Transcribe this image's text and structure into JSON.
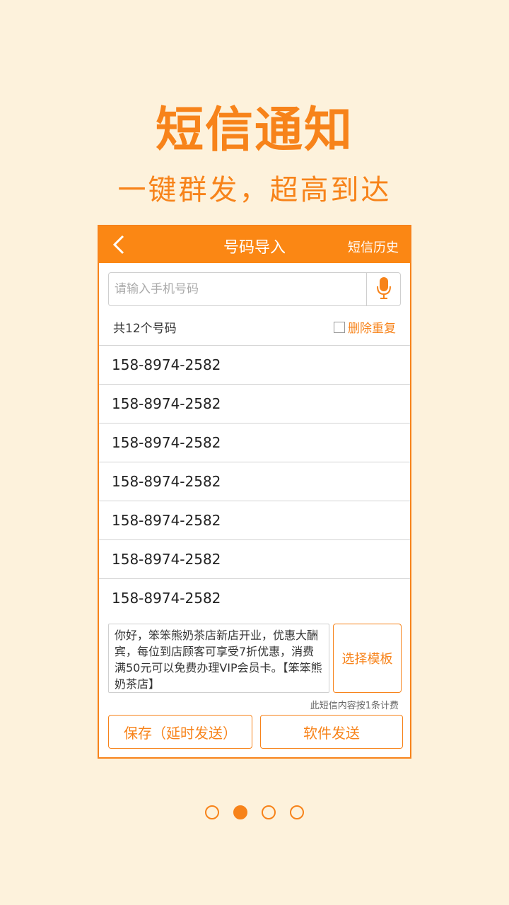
{
  "hero": {
    "title": "短信通知",
    "subtitle": "一键群发，超高到达"
  },
  "header": {
    "back_icon": "chevron-left-icon",
    "title": "号码导入",
    "history_label": "短信历史"
  },
  "search": {
    "placeholder": "请输入手机号码",
    "value": "",
    "mic_icon": "microphone-icon"
  },
  "numbers": {
    "count_label": "共12个号码",
    "dedupe_label": "删除重复",
    "dedupe_checked": false,
    "items": [
      "158-8974-2582",
      "158-8974-2582",
      "158-8974-2582",
      "158-8974-2582",
      "158-8974-2582",
      "158-8974-2582",
      "158-8974-2582"
    ]
  },
  "message": {
    "text": "你好，笨笨熊奶茶店新店开业，优惠大酬宾，每位到店顾客可享受7折优惠，消费满50元可以免费办理VIP会员卡。【笨笨熊奶茶店】",
    "template_button": "选择模板",
    "billing_note": "此短信内容按1条计费"
  },
  "actions": {
    "save_label": "保存（延时发送）",
    "send_label": "软件发送"
  },
  "pager": {
    "total": 4,
    "active_index": 1
  },
  "colors": {
    "accent": "#fb8714",
    "background": "#fdf2dc"
  }
}
